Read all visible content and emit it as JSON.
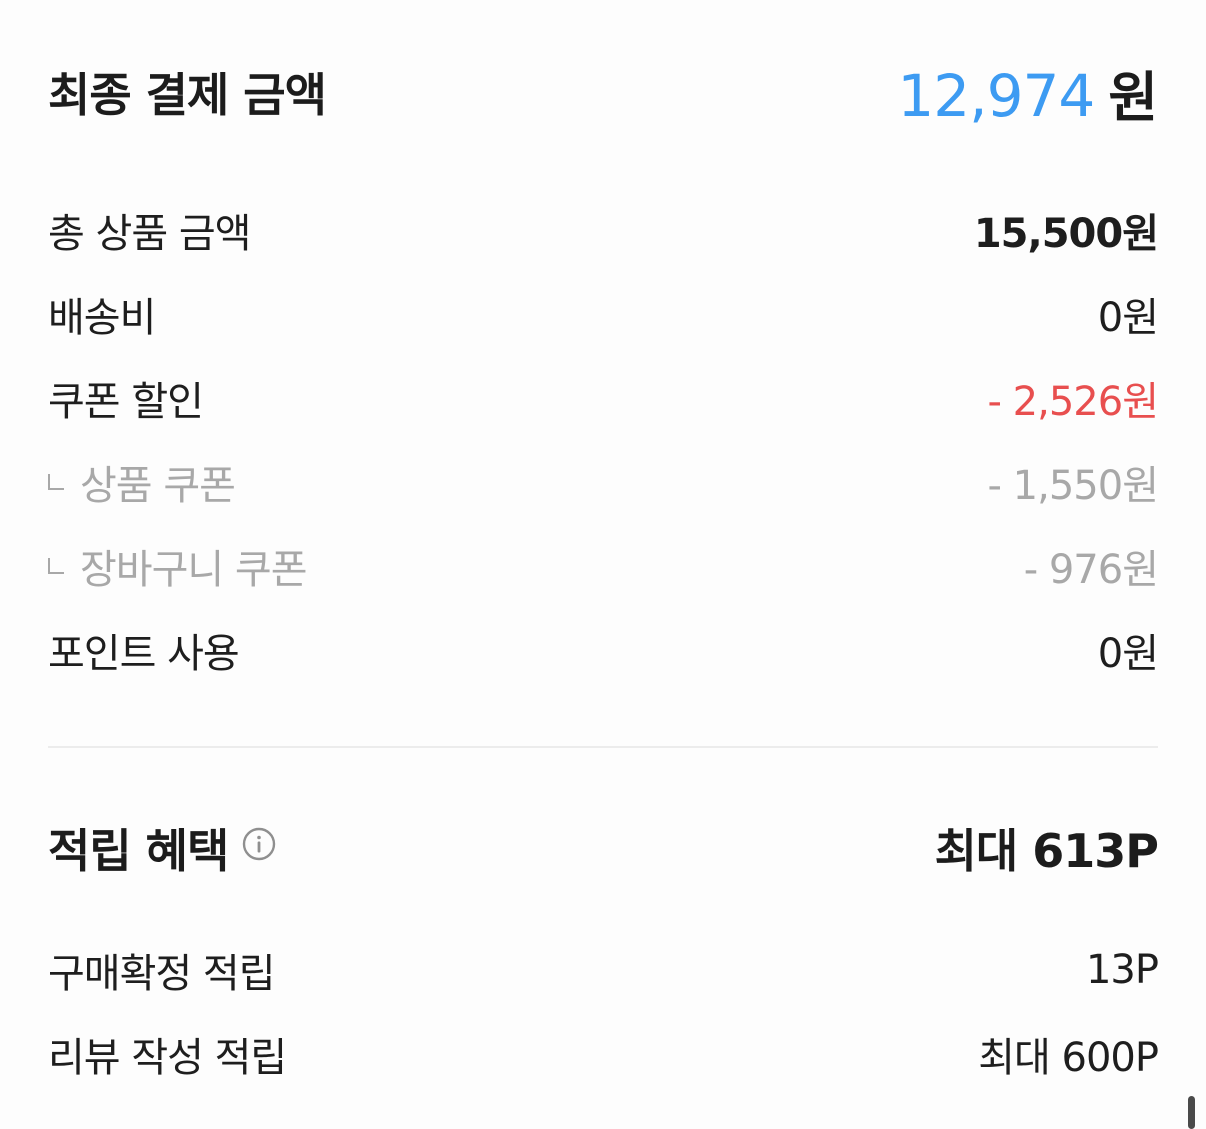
{
  "payment": {
    "final_label": "최종 결제 금액",
    "final_amount": "12,974",
    "final_unit": "원",
    "items": [
      {
        "label": "총 상품 금액",
        "value": "15,500원"
      },
      {
        "label": "배송비",
        "value": "0원"
      },
      {
        "label": "쿠폰 할인",
        "value": "- 2,526원"
      },
      {
        "label": "상품 쿠폰",
        "value": "- 1,550원"
      },
      {
        "label": "장바구니 쿠폰",
        "value": "- 976원"
      },
      {
        "label": "포인트 사용",
        "value": "0원"
      }
    ]
  },
  "rewards": {
    "title": "적립 혜택",
    "max_value": "최대 613P",
    "items": [
      {
        "label": "구매확정 적립",
        "value": "13P"
      },
      {
        "label": "리뷰 작성 적립",
        "value": "최대 600P"
      }
    ]
  },
  "colors": {
    "accent_blue": "#3d9bf2",
    "discount_red": "#e84f4f",
    "muted_gray": "#a8a8a8"
  },
  "icons": {
    "info": "info-circle-icon",
    "sub_item": "corner-bracket-icon"
  }
}
